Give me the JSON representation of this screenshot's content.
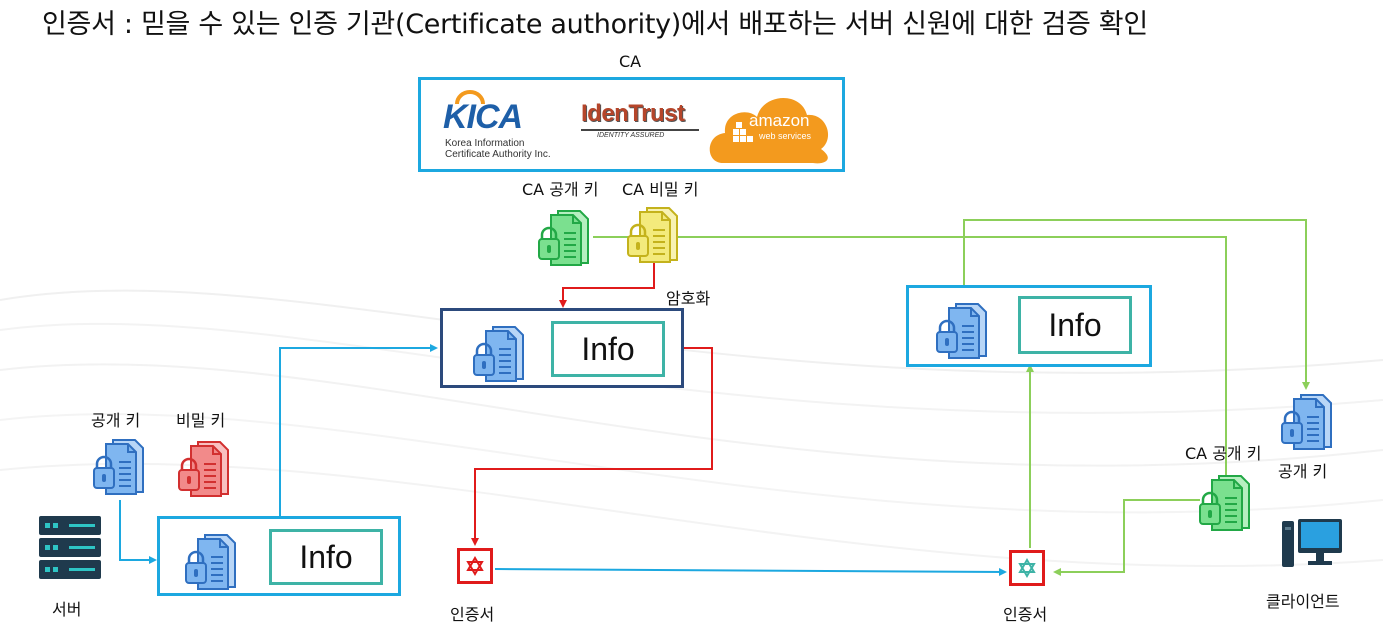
{
  "title": "인증서 : 믿을 수 있는 인증 기관(Certificate authority)에서 배포하는 서버 신원에 대한 검증 확인",
  "ca": {
    "label": "CA",
    "logos": {
      "kica": {
        "mark": "KICA",
        "line1": "Korea Information",
        "line2": "Certificate Authority Inc."
      },
      "identrust": {
        "name": "IdenTrust",
        "tagline": "IDENTITY ASSURED"
      },
      "aws": {
        "name": "amazon",
        "sub": "web services"
      }
    },
    "public_key_label": "CA 공개 키",
    "private_key_label": "CA 비밀 키",
    "encrypt_label": "암호화"
  },
  "server": {
    "public_key_label": "공개 키",
    "private_key_label": "비밀 키",
    "label": "서버",
    "info": "Info"
  },
  "signed_info": "Info",
  "certificate_left_label": "인증서",
  "certificate_right_label": "인증서",
  "verified_info": "Info",
  "client": {
    "ca_public_key_label": "CA 공개 키",
    "public_key_label": "공개 키",
    "label": "클라이언트"
  },
  "colors": {
    "cyan_border": "#1ca8e0",
    "navy_border": "#2c4a7c",
    "teal_info": "#3eb3a6",
    "red_arrow": "#e01b1b",
    "green_arrow": "#8ccf5a",
    "blue_arrow": "#1ca8e0",
    "doc_blue": "#4a8fe0",
    "doc_green": "#3cc65c",
    "doc_yellow": "#e6d83a",
    "doc_red": "#e84a4a"
  }
}
